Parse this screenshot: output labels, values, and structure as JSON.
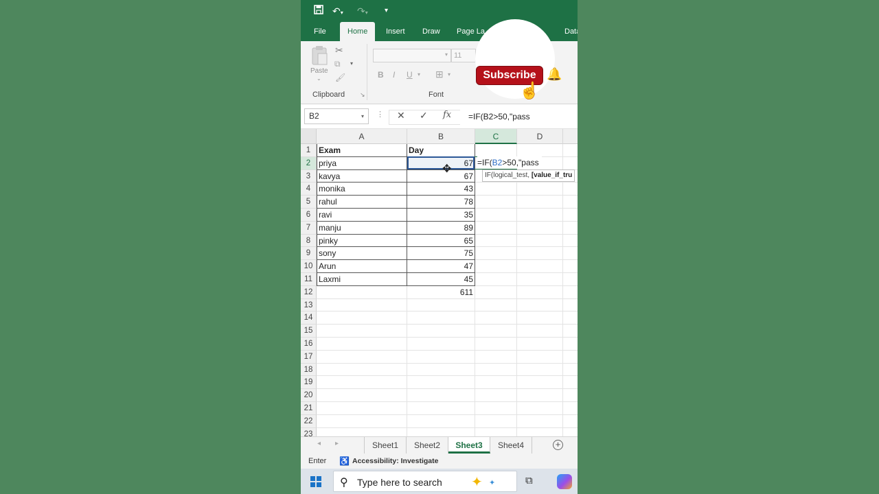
{
  "qat": {
    "save_icon": "save-icon",
    "undo_icon": "undo-icon",
    "redo_icon": "redo-icon",
    "customize_icon": "customize-qat-icon"
  },
  "ribbon_tabs": [
    {
      "label": "File"
    },
    {
      "label": "Home"
    },
    {
      "label": "Insert"
    },
    {
      "label": "Draw"
    },
    {
      "label": "Page La"
    },
    {
      "label": "Data"
    }
  ],
  "ribbon": {
    "paste_label": "Paste",
    "clipboard_label": "Clipboard",
    "font_label": "Font",
    "font_size": "11",
    "bold": "B",
    "italic": "I",
    "underline": "U"
  },
  "formula_bar": {
    "name_box": "B2",
    "formula": "=IF(B2>50,\"pass",
    "cancel_icon": "✕",
    "enter_icon": "✓",
    "fx_label": "fx"
  },
  "grid": {
    "columns": [
      "A",
      "B",
      "C",
      "D"
    ],
    "selected_column": "C",
    "row_numbers": [
      "1",
      "2",
      "3",
      "4",
      "5",
      "6",
      "7",
      "8",
      "9",
      "10",
      "11",
      "12",
      "13",
      "14",
      "15",
      "16",
      "17",
      "18",
      "19",
      "20",
      "21",
      "22",
      "23"
    ],
    "header_row": {
      "a": "Exam",
      "b": "Day"
    },
    "rows": [
      {
        "name": "priya",
        "value": "67"
      },
      {
        "name": "kavya",
        "value": "67"
      },
      {
        "name": "monika",
        "value": "43"
      },
      {
        "name": "rahul",
        "value": "78"
      },
      {
        "name": "ravi",
        "value": "35"
      },
      {
        "name": "manju",
        "value": "89"
      },
      {
        "name": "pinky",
        "value": "65"
      },
      {
        "name": "sony",
        "value": "75"
      },
      {
        "name": "Arun",
        "value": "47"
      },
      {
        "name": "Laxmi",
        "value": "45"
      }
    ],
    "total": "611",
    "edit": {
      "prefix": "=IF(",
      "ref": "B2",
      "suffix": ">50,\"pass"
    },
    "tooltip": {
      "plain": "IF(logical_test, ",
      "bold": "[value_if_tru"
    }
  },
  "sheets": [
    {
      "label": "Sheet1"
    },
    {
      "label": "Sheet2"
    },
    {
      "label": "Sheet3"
    },
    {
      "label": "Sheet4"
    }
  ],
  "active_sheet": "Sheet3",
  "status": {
    "mode": "Enter",
    "accessibility": "Accessibility: Investigate"
  },
  "taskbar": {
    "search_placeholder": "Type here to search"
  },
  "overlay": {
    "subscribe_label": "Subscribe"
  },
  "colors": {
    "excel_green": "#1e7145",
    "background": "#4e875d",
    "subscribe_red": "#b5111a"
  }
}
